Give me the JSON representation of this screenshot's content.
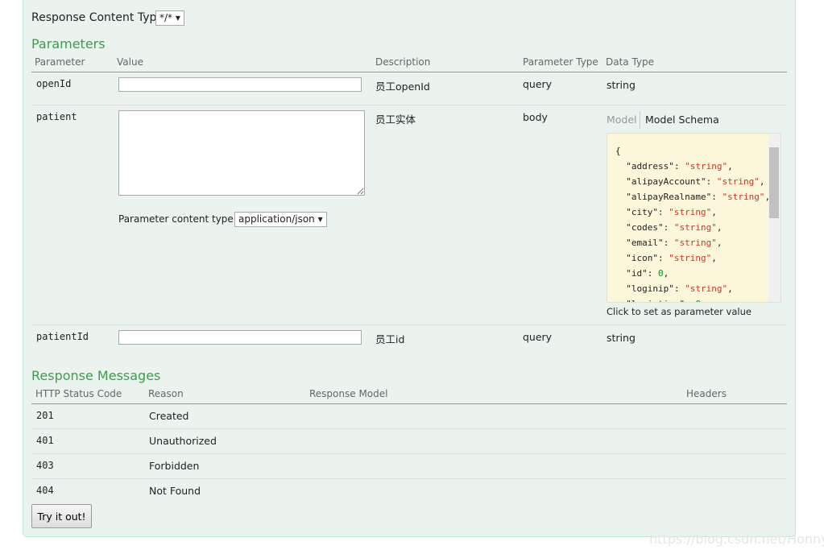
{
  "response_content_type": {
    "label": "Response Content Type",
    "value": "*/* ▾"
  },
  "parameters": {
    "title": "Parameters",
    "headers": [
      "Parameter",
      "Value",
      "Description",
      "Parameter Type",
      "Data Type"
    ],
    "rows": [
      {
        "name": "openId",
        "description": "员工openId",
        "type": "query",
        "data_type": "string"
      },
      {
        "name": "patient",
        "description": "员工实体",
        "type": "body",
        "content_type_label": "Parameter content type:",
        "content_type": "application/json ▾"
      },
      {
        "name": "patientId",
        "description": "员工id",
        "type": "query",
        "data_type": "string"
      }
    ]
  },
  "model_tabs": {
    "model": "Model",
    "schema": "Model Schema",
    "hint": "Click to set as parameter value"
  },
  "response_messages": {
    "title": "Response Messages",
    "headers": [
      "HTTP Status Code",
      "Reason",
      "Response Model",
      "Headers"
    ],
    "rows": [
      {
        "code": "201",
        "reason": "Created"
      },
      {
        "code": "401",
        "reason": "Unauthorized"
      },
      {
        "code": "403",
        "reason": "Forbidden"
      },
      {
        "code": "404",
        "reason": "Not Found"
      }
    ]
  },
  "try_button": "Try it out!",
  "watermark": "https://blog.csdn.net/Honnyee"
}
